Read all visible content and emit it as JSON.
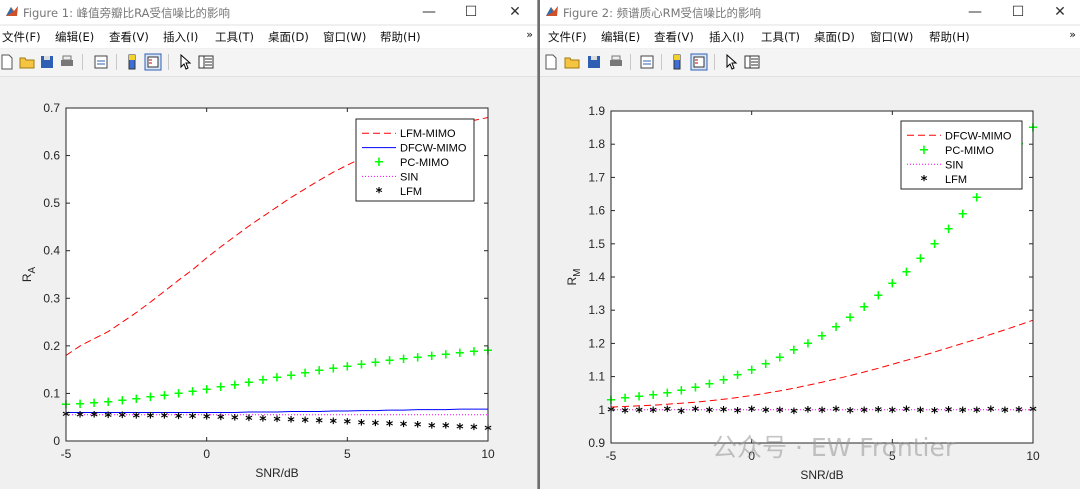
{
  "figure1": {
    "title": "Figure 1: 峰值旁瓣比RA受信噪比的影响",
    "menu": [
      "文件(F)",
      "编辑(E)",
      "查看(V)",
      "插入(I)",
      "工具(T)",
      "桌面(D)",
      "窗口(W)",
      "帮助(H)"
    ]
  },
  "figure2": {
    "title": "Figure 2: 频谱质心RM受信噪比的影响",
    "menu": [
      "文件(F)",
      "编辑(E)",
      "查看(V)",
      "插入(I)",
      "工具(T)",
      "桌面(D)",
      "窗口(W)",
      "帮助(H)"
    ]
  },
  "window_buttons": {
    "minimize": "—",
    "maximize": "☐",
    "close": "✕"
  },
  "menu_more": "»",
  "toolbar_icons": [
    "new-file-icon",
    "open-folder-icon",
    "save-icon",
    "print-icon",
    "link-plot-icon",
    "colorbar-icon",
    "legend-icon",
    "pointer-icon",
    "property-inspector-icon"
  ],
  "watermark": "公众号 · EW Frontier",
  "chart_data": [
    {
      "type": "line",
      "xlabel": "SNR/dB",
      "ylabel": "R",
      "ylabel_sub": "A",
      "xlim": [
        -5,
        10
      ],
      "ylim": [
        0,
        0.7
      ],
      "xticks": [
        -5,
        0,
        5,
        10
      ],
      "yticks": [
        0,
        0.1,
        0.2,
        0.3,
        0.4,
        0.5,
        0.6,
        0.7
      ],
      "grid": false,
      "legend_position": "top-right",
      "x": [
        -5,
        -4.5,
        -4,
        -3.5,
        -3,
        -2.5,
        -2,
        -1.5,
        -1,
        -0.5,
        0,
        0.5,
        1,
        1.5,
        2,
        2.5,
        3,
        3.5,
        4,
        4.5,
        5,
        5.5,
        6,
        6.5,
        7,
        7.5,
        8,
        8.5,
        9,
        9.5,
        10
      ],
      "series": [
        {
          "name": "LFM-MIMO",
          "color": "#ff0000",
          "style": "dashed",
          "values": [
            0.18,
            0.2,
            0.215,
            0.23,
            0.25,
            0.27,
            0.292,
            0.315,
            0.338,
            0.36,
            0.385,
            0.408,
            0.43,
            0.452,
            0.472,
            0.492,
            0.512,
            0.53,
            0.548,
            0.565,
            0.58,
            0.594,
            0.607,
            0.619,
            0.63,
            0.64,
            0.65,
            0.659,
            0.667,
            0.674,
            0.68
          ]
        },
        {
          "name": "DFCW-MIMO",
          "color": "#0000ff",
          "style": "solid",
          "values": [
            0.06,
            0.06,
            0.06,
            0.06,
            0.06,
            0.06,
            0.06,
            0.06,
            0.06,
            0.06,
            0.06,
            0.06,
            0.06,
            0.061,
            0.061,
            0.061,
            0.062,
            0.062,
            0.062,
            0.063,
            0.063,
            0.064,
            0.064,
            0.065,
            0.065,
            0.066,
            0.066,
            0.066,
            0.067,
            0.067,
            0.067
          ]
        },
        {
          "name": "PC-MIMO",
          "color": "#00ff00",
          "style": "plus",
          "values": [
            0.077,
            0.078,
            0.08,
            0.082,
            0.085,
            0.088,
            0.092,
            0.096,
            0.1,
            0.104,
            0.108,
            0.113,
            0.118,
            0.123,
            0.128,
            0.133,
            0.138,
            0.143,
            0.148,
            0.152,
            0.157,
            0.161,
            0.165,
            0.169,
            0.172,
            0.176,
            0.179,
            0.182,
            0.185,
            0.188,
            0.19
          ]
        },
        {
          "name": "SIN",
          "color": "#ff00ff",
          "style": "dotted",
          "values": [
            0.055,
            0.055,
            0.055,
            0.055,
            0.055,
            0.055,
            0.055,
            0.055,
            0.055,
            0.055,
            0.055,
            0.055,
            0.055,
            0.055,
            0.055,
            0.055,
            0.055,
            0.055,
            0.055,
            0.055,
            0.055,
            0.055,
            0.055,
            0.055,
            0.055,
            0.055,
            0.055,
            0.055,
            0.055,
            0.055,
            0.055
          ]
        },
        {
          "name": "LFM",
          "color": "#000000",
          "style": "star",
          "values": [
            0.055,
            0.054,
            0.054,
            0.053,
            0.053,
            0.052,
            0.052,
            0.051,
            0.05,
            0.05,
            0.049,
            0.048,
            0.047,
            0.046,
            0.045,
            0.044,
            0.043,
            0.042,
            0.041,
            0.04,
            0.039,
            0.037,
            0.036,
            0.035,
            0.034,
            0.033,
            0.031,
            0.03,
            0.028,
            0.027,
            0.025
          ]
        }
      ]
    },
    {
      "type": "line",
      "xlabel": "SNR/dB",
      "ylabel": "R",
      "ylabel_sub": "M",
      "xlim": [
        -5,
        10
      ],
      "ylim": [
        0.9,
        1.9
      ],
      "xticks": [
        -5,
        0,
        5,
        10
      ],
      "yticks": [
        0.9,
        1,
        1.1,
        1.2,
        1.3,
        1.4,
        1.5,
        1.6,
        1.7,
        1.8,
        1.9
      ],
      "grid": false,
      "legend_position": "top-right",
      "x": [
        -5,
        -4.5,
        -4,
        -3.5,
        -3,
        -2.5,
        -2,
        -1.5,
        -1,
        -0.5,
        0,
        0.5,
        1,
        1.5,
        2,
        2.5,
        3,
        3.5,
        4,
        4.5,
        5,
        5.5,
        6,
        6.5,
        7,
        7.5,
        8,
        8.5,
        9,
        9.5,
        10
      ],
      "series": [
        {
          "name": "DFCW-MIMO",
          "color": "#ff0000",
          "style": "dashed",
          "values": [
            1.008,
            1.01,
            1.012,
            1.014,
            1.017,
            1.02,
            1.023,
            1.027,
            1.032,
            1.037,
            1.043,
            1.05,
            1.057,
            1.065,
            1.074,
            1.083,
            1.093,
            1.103,
            1.114,
            1.125,
            1.137,
            1.149,
            1.161,
            1.174,
            1.187,
            1.2,
            1.213,
            1.227,
            1.241,
            1.255,
            1.27
          ]
        },
        {
          "name": "PC-MIMO",
          "color": "#00ff00",
          "style": "plus",
          "values": [
            1.03,
            1.035,
            1.04,
            1.045,
            1.05,
            1.058,
            1.067,
            1.077,
            1.09,
            1.105,
            1.12,
            1.138,
            1.158,
            1.18,
            1.2,
            1.223,
            1.25,
            1.278,
            1.31,
            1.345,
            1.38,
            1.415,
            1.455,
            1.5,
            1.545,
            1.59,
            1.64,
            1.69,
            1.745,
            1.8,
            1.85
          ]
        },
        {
          "name": "SIN",
          "color": "#ff00ff",
          "style": "dotted",
          "values": [
            1,
            1,
            1,
            1,
            1,
            1,
            1,
            1,
            1,
            1,
            1,
            1,
            1,
            1,
            1,
            1,
            1,
            1,
            1,
            1,
            1,
            1,
            1,
            1,
            1,
            1,
            1,
            1,
            1,
            1,
            1
          ]
        },
        {
          "name": "LFM",
          "color": "#000000",
          "style": "star",
          "values": [
            0.998,
            0.995,
            0.997,
            0.996,
            0.999,
            0.994,
            1.0,
            0.997,
            0.998,
            0.995,
            0.999,
            0.996,
            0.997,
            0.994,
            0.998,
            0.996,
            0.999,
            0.995,
            0.997,
            0.998,
            0.996,
            0.999,
            0.997,
            0.995,
            0.998,
            0.997,
            0.996,
            0.999,
            0.997,
            0.998,
            1.0
          ]
        }
      ]
    }
  ]
}
